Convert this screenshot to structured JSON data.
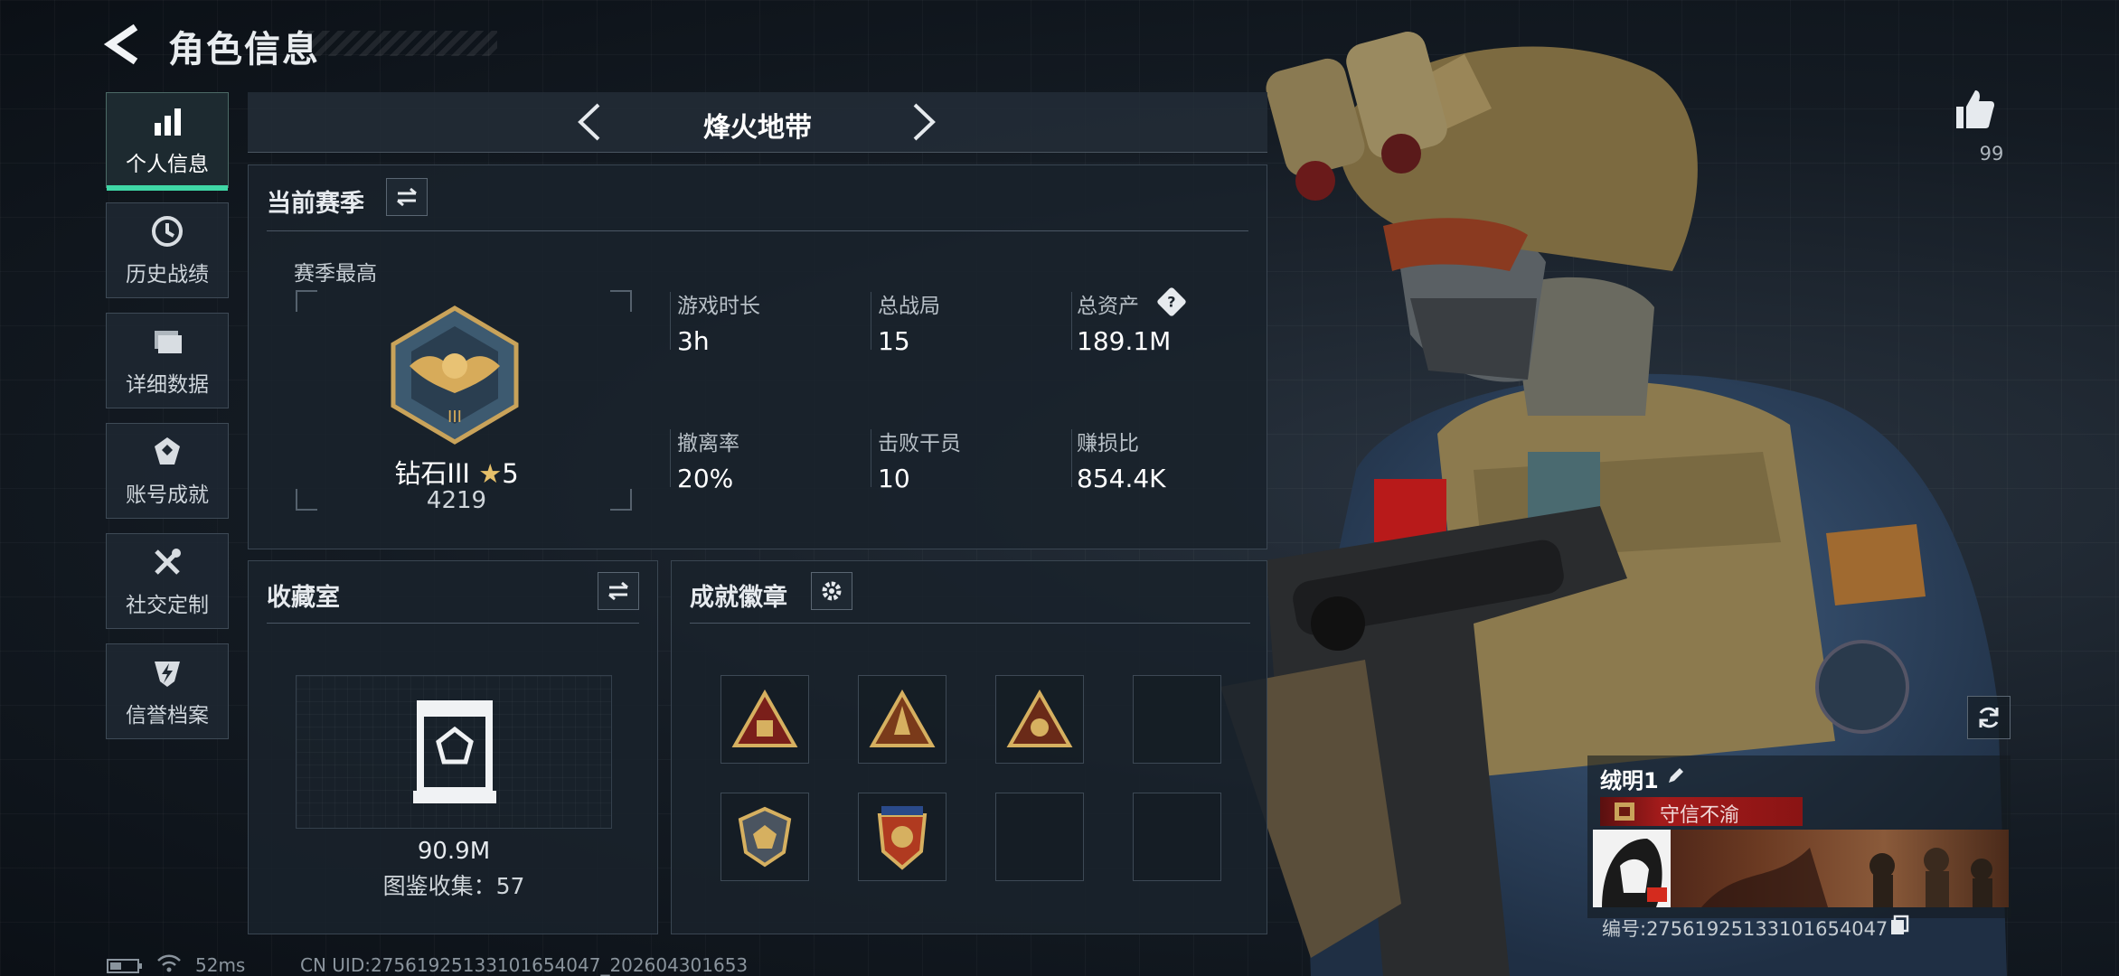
{
  "header": {
    "title": "角色信息"
  },
  "sidebar": {
    "items": [
      {
        "label": "个人信息",
        "icon": "bar-chart-icon",
        "active": true
      },
      {
        "label": "历史战绩",
        "icon": "history-icon"
      },
      {
        "label": "详细数据",
        "icon": "folder-icon"
      },
      {
        "label": "账号成就",
        "icon": "medal-icon"
      },
      {
        "label": "社交定制",
        "icon": "tools-icon"
      },
      {
        "label": "信誉档案",
        "icon": "shield-lightning-icon"
      }
    ]
  },
  "mode": {
    "name": "烽火地带"
  },
  "season": {
    "title": "当前赛季",
    "best_label": "赛季最高",
    "rank_name": "钻石III",
    "rank_stars": "5",
    "rank_score": "4219",
    "stats": [
      {
        "label": "游戏时长",
        "value": "3h"
      },
      {
        "label": "总战局",
        "value": "15"
      },
      {
        "label": "总资产",
        "value": "189.1M"
      },
      {
        "label": "撤离率",
        "value": "20%"
      },
      {
        "label": "击败干员",
        "value": "10"
      },
      {
        "label": "赚损比",
        "value": "854.4K"
      }
    ],
    "help_icon": "?"
  },
  "collection": {
    "title": "收藏室",
    "value": "90.9M",
    "catalog": "图鉴收集：57"
  },
  "achievements": {
    "title": "成就徽章"
  },
  "profile": {
    "likes": "99",
    "name": "绒明1",
    "title": "守信不渝",
    "uid_line": "编号:2756192513310165404​7"
  },
  "status": {
    "ping": "52ms",
    "cn_uid": "CN UID:27561925133101654047_202604301653"
  },
  "colors": {
    "accent": "#3fd7a6",
    "title_red": "#a41b1b"
  }
}
